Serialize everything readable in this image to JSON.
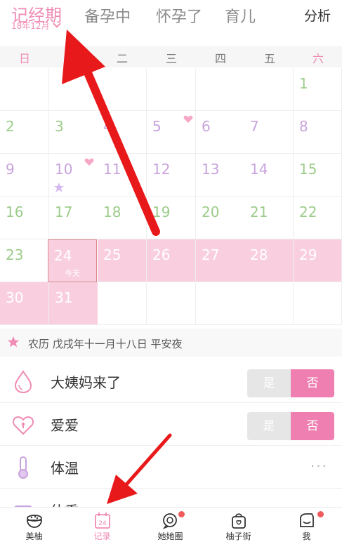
{
  "header": {
    "active_tab": "记经期",
    "month": "18年12月",
    "tabs": [
      "备孕中",
      "怀孕了",
      "育儿"
    ],
    "analysis": "分析"
  },
  "weekdays": [
    "日",
    "一",
    "二",
    "三",
    "四",
    "五",
    "六"
  ],
  "calendar": {
    "today_label": "今天",
    "days": [
      "1",
      "2",
      "3",
      "4",
      "5",
      "6",
      "7",
      "8",
      "9",
      "10",
      "11",
      "12",
      "13",
      "14",
      "15",
      "16",
      "17",
      "18",
      "19",
      "20",
      "21",
      "22",
      "23",
      "24",
      "25",
      "26",
      "27",
      "28",
      "29",
      "30",
      "31"
    ]
  },
  "lunar": {
    "text": "农历 戊戌年十一月十八日 平安夜"
  },
  "records": [
    {
      "label": "大姨妈来了",
      "yes": "是",
      "no": "否"
    },
    {
      "label": "爱爱",
      "yes": "是",
      "no": "否"
    },
    {
      "label": "体温",
      "more": "···"
    },
    {
      "label": "体重"
    }
  ],
  "bottom_nav": [
    {
      "label": "美柚"
    },
    {
      "label": "记录"
    },
    {
      "label": "她她圈"
    },
    {
      "label": "柚子街"
    },
    {
      "label": "我"
    }
  ],
  "colors": {
    "accent": "#f08bb4",
    "period_bg": "#f9cfe0",
    "green_day": "#9ccc8a",
    "purple_day": "#c9a3dd",
    "annotation_arrow": "#e8191b"
  }
}
